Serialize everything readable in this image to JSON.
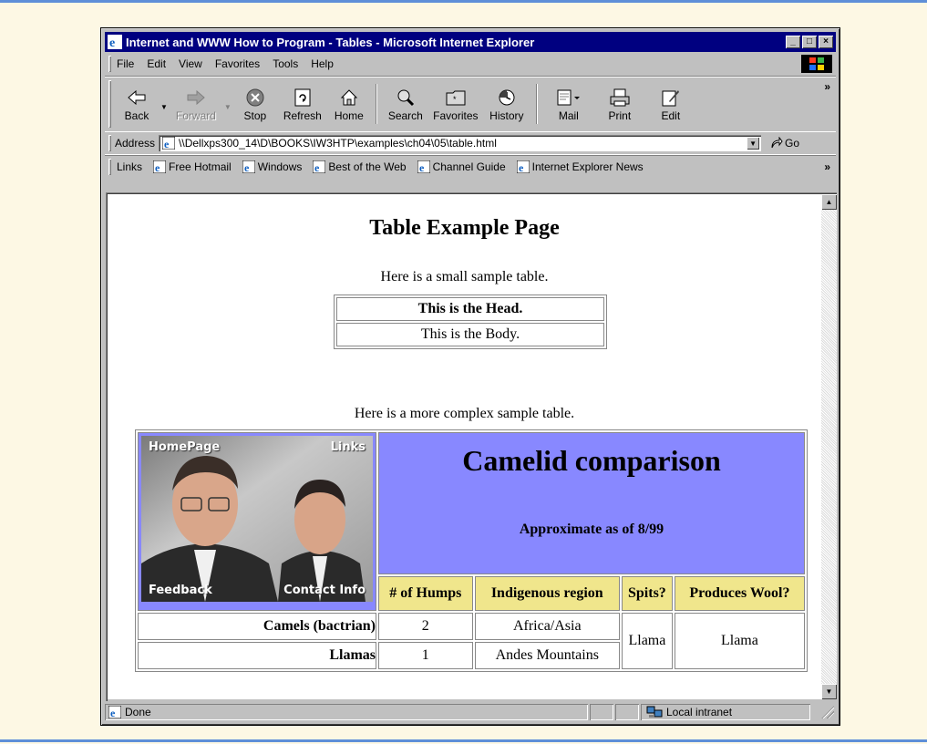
{
  "window": {
    "title": "Internet and WWW How to Program - Tables - Microsoft Internet Explorer",
    "minimize": "_",
    "maximize": "□",
    "close": "×"
  },
  "menu": {
    "items": [
      {
        "label": "File"
      },
      {
        "label": "Edit"
      },
      {
        "label": "View"
      },
      {
        "label": "Favorites"
      },
      {
        "label": "Tools"
      },
      {
        "label": "Help"
      }
    ]
  },
  "toolbar": {
    "back": "Back",
    "forward": "Forward",
    "stop": "Stop",
    "refresh": "Refresh",
    "home": "Home",
    "search": "Search",
    "favorites": "Favorites",
    "history": "History",
    "mail": "Mail",
    "print": "Print",
    "edit": "Edit",
    "more": "»"
  },
  "address": {
    "label": "Address",
    "url": "\\\\Dellxps300_14\\D\\BOOKS\\IW3HTP\\examples\\ch04\\05\\table.html",
    "go": "Go"
  },
  "links": {
    "label": "Links",
    "items": [
      {
        "label": "Free Hotmail"
      },
      {
        "label": "Windows"
      },
      {
        "label": "Best of the Web"
      },
      {
        "label": "Channel Guide"
      },
      {
        "label": "Internet Explorer News"
      }
    ],
    "more": "»"
  },
  "page": {
    "heading": "Table Example Page",
    "caption1": "Here is a small sample table.",
    "small_table": {
      "head": "This is the Head.",
      "body": "This is the Body."
    },
    "caption2": "Here is a more complex sample table.",
    "complex_table": {
      "photo_labels": {
        "top_left": "HomePage",
        "top_right": "Links",
        "bottom_left": "Feedback",
        "bottom_right": "Contact Info"
      },
      "title": "Camelid comparison",
      "subtitle": "Approximate as of 8/99",
      "columns": [
        "# of Humps",
        "Indigenous region",
        "Spits?",
        "Produces Wool?"
      ],
      "rows": [
        {
          "name": "Camels (bactrian)",
          "humps": "2",
          "region": "Africa/Asia"
        },
        {
          "name": "Llamas",
          "humps": "1",
          "region": "Andes Mountains"
        }
      ],
      "spits": "Llama",
      "wool": "Llama"
    }
  },
  "status": {
    "text": "Done",
    "zone": "Local intranet"
  },
  "colors": {
    "title_bar": "#000080",
    "header_cell": "#8888ff",
    "column_head": "#f0e68c",
    "page_background": "#fdf8e4"
  }
}
